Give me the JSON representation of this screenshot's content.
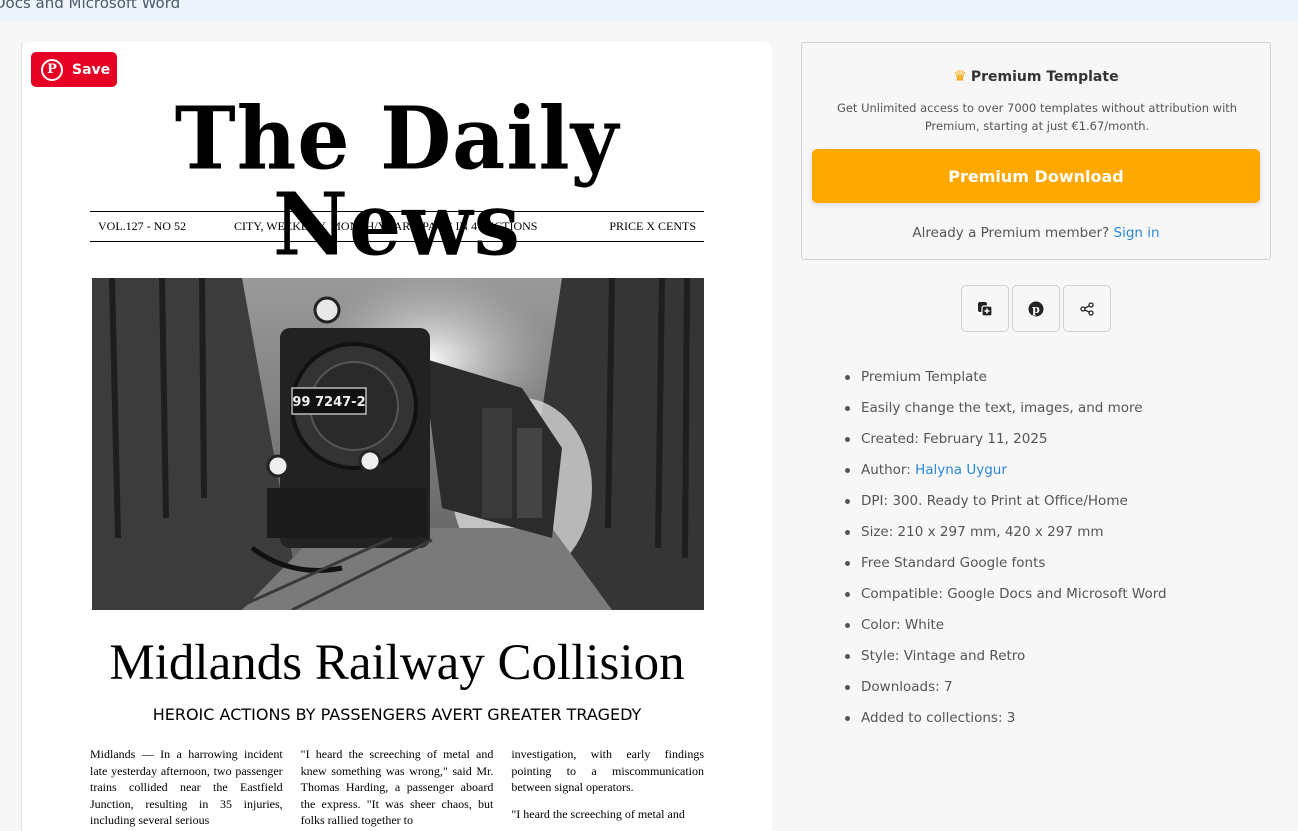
{
  "top_strip": {
    "text": "Docs and Microsoft Word"
  },
  "pinterest": {
    "save_label": "Save",
    "glyph": "P"
  },
  "newspaper": {
    "masthead": "The Daily News",
    "vol": "VOL.127 - NO 52",
    "city_line": "CITY, WEEKDAY, MONTH/YEAR 8  PAGE IN 4 SECTIONS",
    "price": "PRICE X CENTS",
    "locomotive_plate": "99 7247-2",
    "headline": "Midlands Railway Collision",
    "subheadline": "HEROIC ACTIONS BY PASSENGERS AVERT GREATER TRAGEDY",
    "col1": "Midlands — In a harrowing incident late yesterday afternoon, two passenger trains collided near the Eastfield Junction, resulting in 35 injuries, including several serious",
    "col2": "\"I heard the screeching of metal and knew something was wrong,\" said Mr. Thomas Harding, a passenger aboard the express. \"It was sheer chaos, but folks rallied together to",
    "col3a": "investigation, with early findings pointing to a miscommunication between signal operators.",
    "col3b": "\"I heard the screeching of metal and"
  },
  "premium": {
    "title": "Premium Template",
    "description": "Get Unlimited access to over 7000 templates without attribution with Premium, starting at just €1.67/month.",
    "button_label": "Premium Download",
    "member_text": "Already a Premium member?",
    "sign_in_label": "Sign in",
    "accent_color": "#ffa800",
    "crown_icon": "crown-icon"
  },
  "actions": [
    {
      "name": "add-to-collection",
      "icon": "copy-plus-icon"
    },
    {
      "name": "pinterest",
      "icon": "pinterest-icon"
    },
    {
      "name": "share",
      "icon": "share-icon"
    }
  ],
  "details": {
    "premium": "Premium Template",
    "easily": "Easily change the text, images, and more",
    "created": "Created: February 11, 2025",
    "author_label": "Author: ",
    "author_name": "Halyna Uygur",
    "dpi": "DPI: 300. Ready to Print at Office/Home",
    "size": "Size: 210 x 297 mm, 420 x 297 mm",
    "fonts": "Free Standard Google fonts",
    "compatible": "Compatible: Google Docs and Microsoft Word",
    "color": "Color: White",
    "style": "Style: Vintage and Retro",
    "downloads": "Downloads: 7",
    "collections": "Added to collections: 3"
  }
}
